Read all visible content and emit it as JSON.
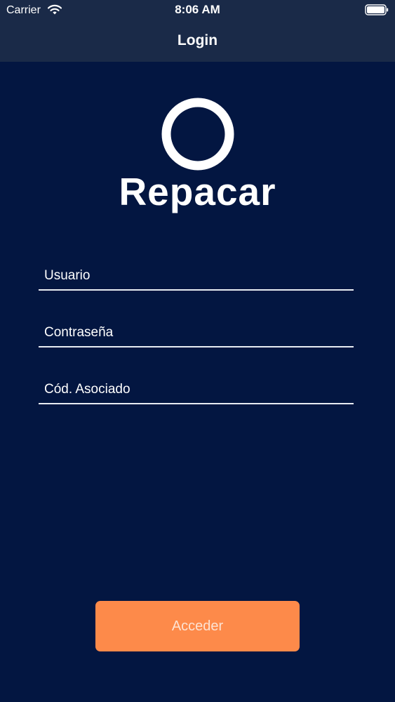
{
  "status_bar": {
    "carrier": "Carrier",
    "wifi_icon": "wifi-icon",
    "time": "8:06 AM",
    "battery_icon": "battery-icon"
  },
  "nav_bar": {
    "title": "Login"
  },
  "logo": {
    "ring_icon": "ring-logo-icon",
    "text": "Repacar"
  },
  "form": {
    "usuario_placeholder": "Usuario",
    "contrasena_placeholder": "Contraseña",
    "codigo_placeholder": "Cód. Asociado"
  },
  "submit_label": "Acceder",
  "colors": {
    "background": "#031641",
    "nav_bar": "#1a2a48",
    "button": "#fd8a4a",
    "button_text": "#fde2d2",
    "field_line": "#e8ecf2"
  }
}
